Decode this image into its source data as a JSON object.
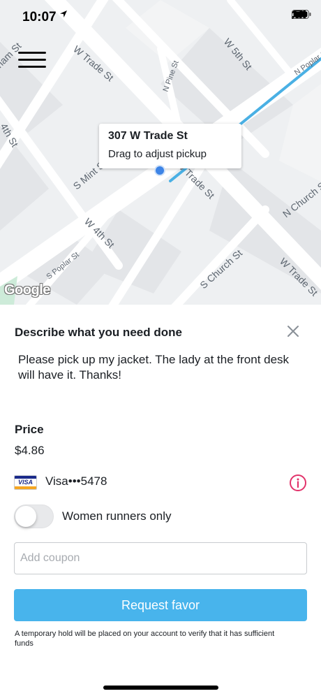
{
  "status_bar": {
    "time": "10:07",
    "location_icon": "location-arrow-icon",
    "signal_icon": "cellular-signal-icon",
    "wifi_icon": "wifi-icon",
    "battery_icon": "battery-icon"
  },
  "map": {
    "menu_icon": "hamburger-menu-icon",
    "callout": {
      "address": "307 W Trade St",
      "hint": "Drag to adjust pickup"
    },
    "street_labels": [
      "W Trade St",
      "N Pine St",
      "W 5th St",
      "N Poplar St",
      "S Mint St",
      "W Trade St",
      "N Church St",
      "W 4th St",
      "S Poplar St",
      "S Church St",
      "W Trade St",
      "ham St",
      "4th St"
    ],
    "attribution": "Google",
    "route_color": "#4ab0e4",
    "pin_color": "#3d84e6"
  },
  "sheet": {
    "title": "Describe what you need done",
    "close_icon": "close-icon",
    "description": "Please pick up my jacket. The lady at the front desk will have it. Thanks!",
    "price_label": "Price",
    "price_value": "$4.86",
    "card": {
      "brand_icon": "visa-card-icon",
      "brand_text": "VISA",
      "text": "Visa•••5478",
      "info_icon": "info-icon",
      "info_color": "#e2336b"
    },
    "women_only": {
      "label": "Women runners only",
      "enabled": false
    },
    "coupon": {
      "placeholder": "Add coupon",
      "value": ""
    },
    "request_button": "Request favor",
    "accent_color": "#48b4ec",
    "hold_note": "A temporary hold will be placed on your account to verify that it has sufficient funds"
  }
}
